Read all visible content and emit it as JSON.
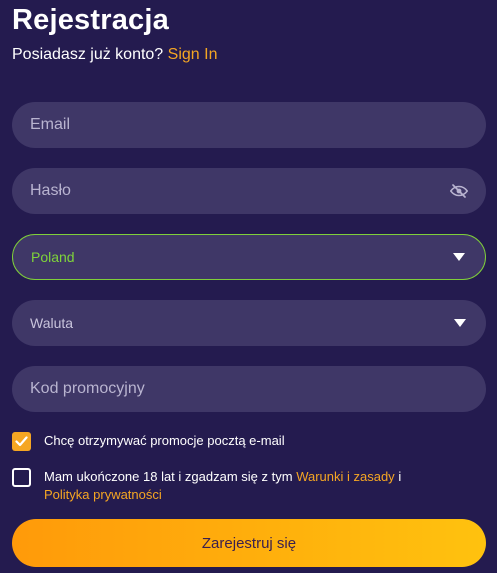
{
  "header": {
    "title": "Rejestracja",
    "subtitle_text": "Posiadasz już konto?",
    "signin_link": "Sign In"
  },
  "form": {
    "email": {
      "placeholder": "Email",
      "value": ""
    },
    "password": {
      "placeholder": "Hasło",
      "value": "",
      "icon": "eye-off-icon"
    },
    "country": {
      "value": "Poland",
      "icon": "chevron-down-icon"
    },
    "currency": {
      "value": "Waluta",
      "icon": "chevron-down-icon"
    },
    "promo": {
      "placeholder": "Kod promocyjny",
      "value": ""
    },
    "promo_email_checkbox": {
      "label": "Chcę otrzymywać promocje pocztą e-mail",
      "checked": true
    },
    "terms_checkbox": {
      "label_before": "Mam ukończone 18 lat i zgadzam się z tym",
      "terms_link": "Warunki i zasady",
      "label_and": "i",
      "privacy_link": "Polityka prywatności",
      "checked": false
    },
    "submit_label": "Zarejestruj się"
  },
  "colors": {
    "background": "#241b4f",
    "field": "#3f3767",
    "accent": "#f5a623",
    "country_border": "#7fcf3a",
    "button_gradient_start": "#ff9a0a",
    "button_gradient_end": "#ffc20e"
  }
}
